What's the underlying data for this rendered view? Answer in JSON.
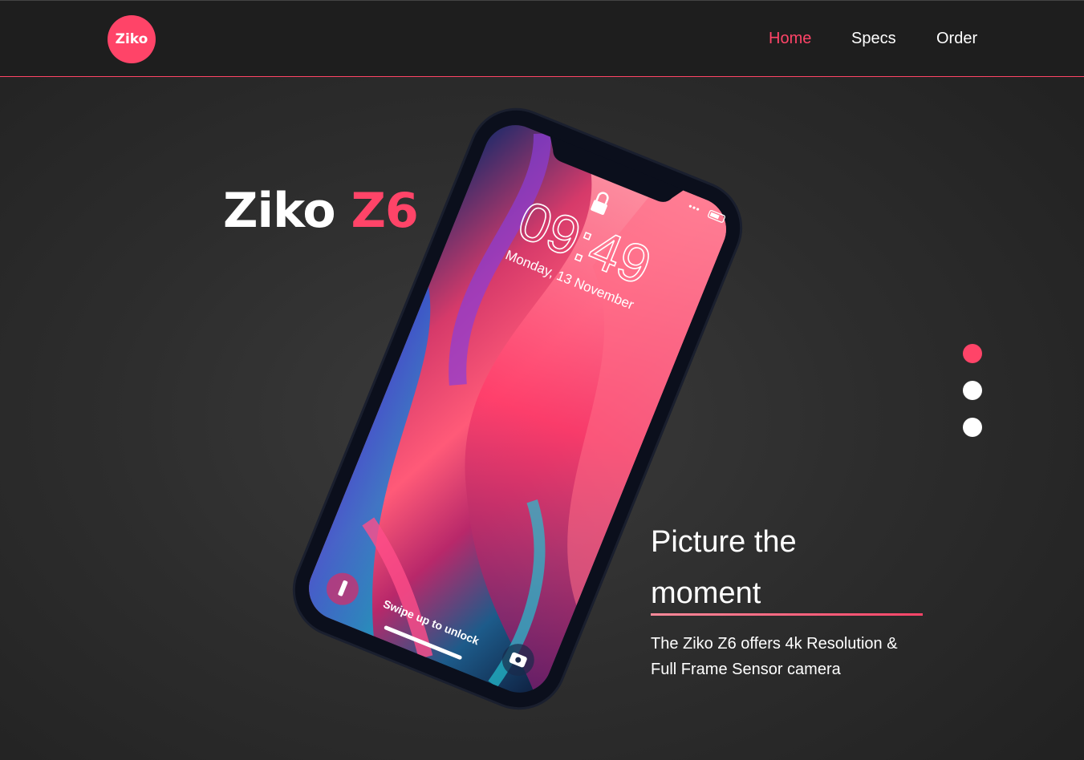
{
  "header": {
    "logo_text": "Ziko",
    "nav": [
      {
        "label": "Home",
        "active": true
      },
      {
        "label": "Specs",
        "active": false
      },
      {
        "label": "Order",
        "active": false
      }
    ]
  },
  "hero": {
    "brand": "Ziko",
    "model": "Z6",
    "tagline": "Picture the moment",
    "description": "The Ziko Z6 offers 4k Resolution & Full Frame Sensor camera"
  },
  "phone_screen": {
    "time": "09:49",
    "date": "Monday, 13 November",
    "unlock_hint": "Swipe up to unlock"
  },
  "slider": {
    "count": 3,
    "active_index": 0
  },
  "colors": {
    "accent": "#ff4468",
    "header_bg": "#1e1e1e",
    "page_bg": "#2d2d2d"
  }
}
